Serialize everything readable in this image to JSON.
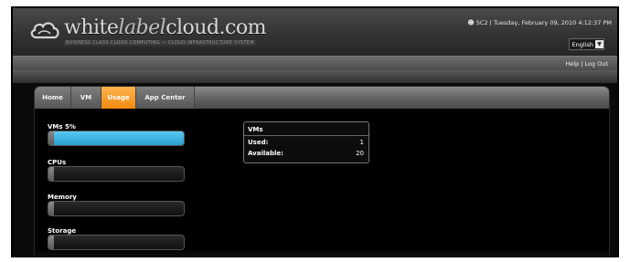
{
  "brand": {
    "name_part1": "white",
    "name_accent": "label",
    "name_part2": "cloud.com",
    "tagline": "BUSINESS CLASS CLOUD COMPUTING — CLOUD INFRASTRUCTURE SYSTEM"
  },
  "header": {
    "user": "SC2",
    "separator": "|",
    "datetime": "Tuesday, February 09, 2010 4:12:37 PM",
    "language": "English"
  },
  "subbar": {
    "help_label": "Help",
    "separator": "|",
    "logout_label": "Log Out"
  },
  "tabs": [
    {
      "label": "Home",
      "active": false
    },
    {
      "label": "VM",
      "active": false
    },
    {
      "label": "Usage",
      "active": true
    },
    {
      "label": "App Center",
      "active": false
    }
  ],
  "usage": {
    "meters": [
      {
        "label": "VMs 5%",
        "percent": 100
      },
      {
        "label": "CPUs",
        "percent": 0
      },
      {
        "label": "Memory",
        "percent": 0
      },
      {
        "label": "Storage",
        "percent": 0
      }
    ],
    "vm_summary": {
      "title": "VMs",
      "used_label": "Used:",
      "used_value": "1",
      "available_label": "Available:",
      "available_value": "20"
    }
  },
  "colors": {
    "active_tab": "#f08a10",
    "meter_fill": "#2a9fd0"
  }
}
